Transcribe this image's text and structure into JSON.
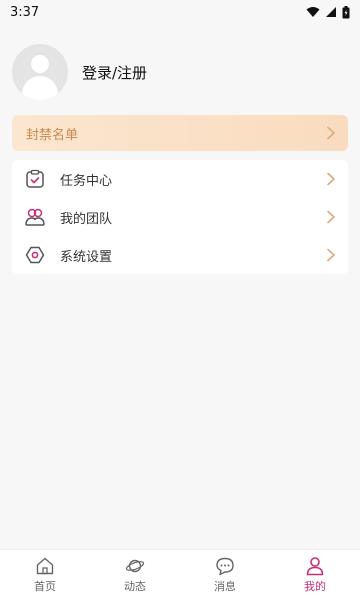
{
  "status_bar": {
    "time": "3:37"
  },
  "profile": {
    "login_label": "登录/注册"
  },
  "blacklist": {
    "label": "封禁名单"
  },
  "menu": {
    "items": [
      {
        "label": "任务中心",
        "icon": "task-clipboard-icon"
      },
      {
        "label": "我的团队",
        "icon": "team-people-icon"
      },
      {
        "label": "系统设置",
        "icon": "settings-hex-icon"
      }
    ]
  },
  "bottom_nav": {
    "items": [
      {
        "label": "首页",
        "icon": "home-icon"
      },
      {
        "label": "动态",
        "icon": "planet-icon"
      },
      {
        "label": "消息",
        "icon": "chat-icon"
      },
      {
        "label": "我的",
        "icon": "user-icon",
        "active": true
      }
    ]
  },
  "colors": {
    "accent": "#c4317a",
    "blacklist_text": "#c88a4f",
    "chevron": "#d8ab7c",
    "background": "#f7f7f7"
  }
}
